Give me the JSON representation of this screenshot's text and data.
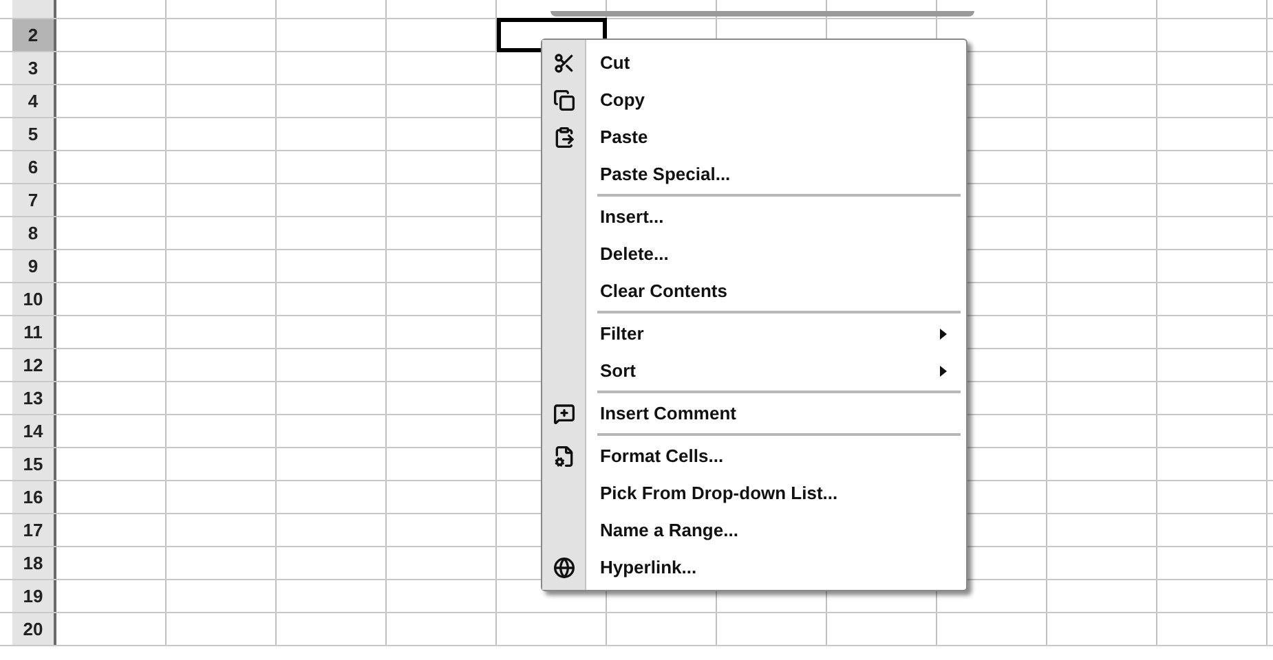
{
  "rows": [
    {
      "label": "2",
      "selected": true
    },
    {
      "label": "3",
      "selected": false
    },
    {
      "label": "4",
      "selected": false
    },
    {
      "label": "5",
      "selected": false
    },
    {
      "label": "6",
      "selected": false
    },
    {
      "label": "7",
      "selected": false
    },
    {
      "label": "8",
      "selected": false
    },
    {
      "label": "9",
      "selected": false
    },
    {
      "label": "10",
      "selected": false
    },
    {
      "label": "11",
      "selected": false
    },
    {
      "label": "12",
      "selected": false
    },
    {
      "label": "13",
      "selected": false
    },
    {
      "label": "14",
      "selected": false
    },
    {
      "label": "15",
      "selected": false
    },
    {
      "label": "16",
      "selected": false
    },
    {
      "label": "17",
      "selected": false
    },
    {
      "label": "18",
      "selected": false
    },
    {
      "label": "19",
      "selected": false
    },
    {
      "label": "20",
      "selected": false
    }
  ],
  "context_menu": {
    "items": [
      {
        "kind": "command",
        "label": "Cut",
        "submenu": false
      },
      {
        "kind": "command",
        "label": "Copy",
        "submenu": false
      },
      {
        "kind": "command",
        "label": "Paste",
        "submenu": false
      },
      {
        "kind": "command",
        "label": "Paste Special...",
        "submenu": false
      },
      {
        "kind": "separator"
      },
      {
        "kind": "command",
        "label": "Insert...",
        "submenu": false
      },
      {
        "kind": "command",
        "label": "Delete...",
        "submenu": false
      },
      {
        "kind": "command",
        "label": "Clear Contents",
        "submenu": false
      },
      {
        "kind": "separator"
      },
      {
        "kind": "command",
        "label": "Filter",
        "submenu": true
      },
      {
        "kind": "command",
        "label": "Sort",
        "submenu": true
      },
      {
        "kind": "separator"
      },
      {
        "kind": "command",
        "label": "Insert Comment",
        "submenu": false
      },
      {
        "kind": "separator"
      },
      {
        "kind": "command",
        "label": "Format Cells...",
        "submenu": false
      },
      {
        "kind": "command",
        "label": "Pick From Drop-down List...",
        "submenu": false
      },
      {
        "kind": "command",
        "label": "Name a Range...",
        "submenu": false
      },
      {
        "kind": "command",
        "label": "Hyperlink...",
        "submenu": false
      }
    ]
  }
}
